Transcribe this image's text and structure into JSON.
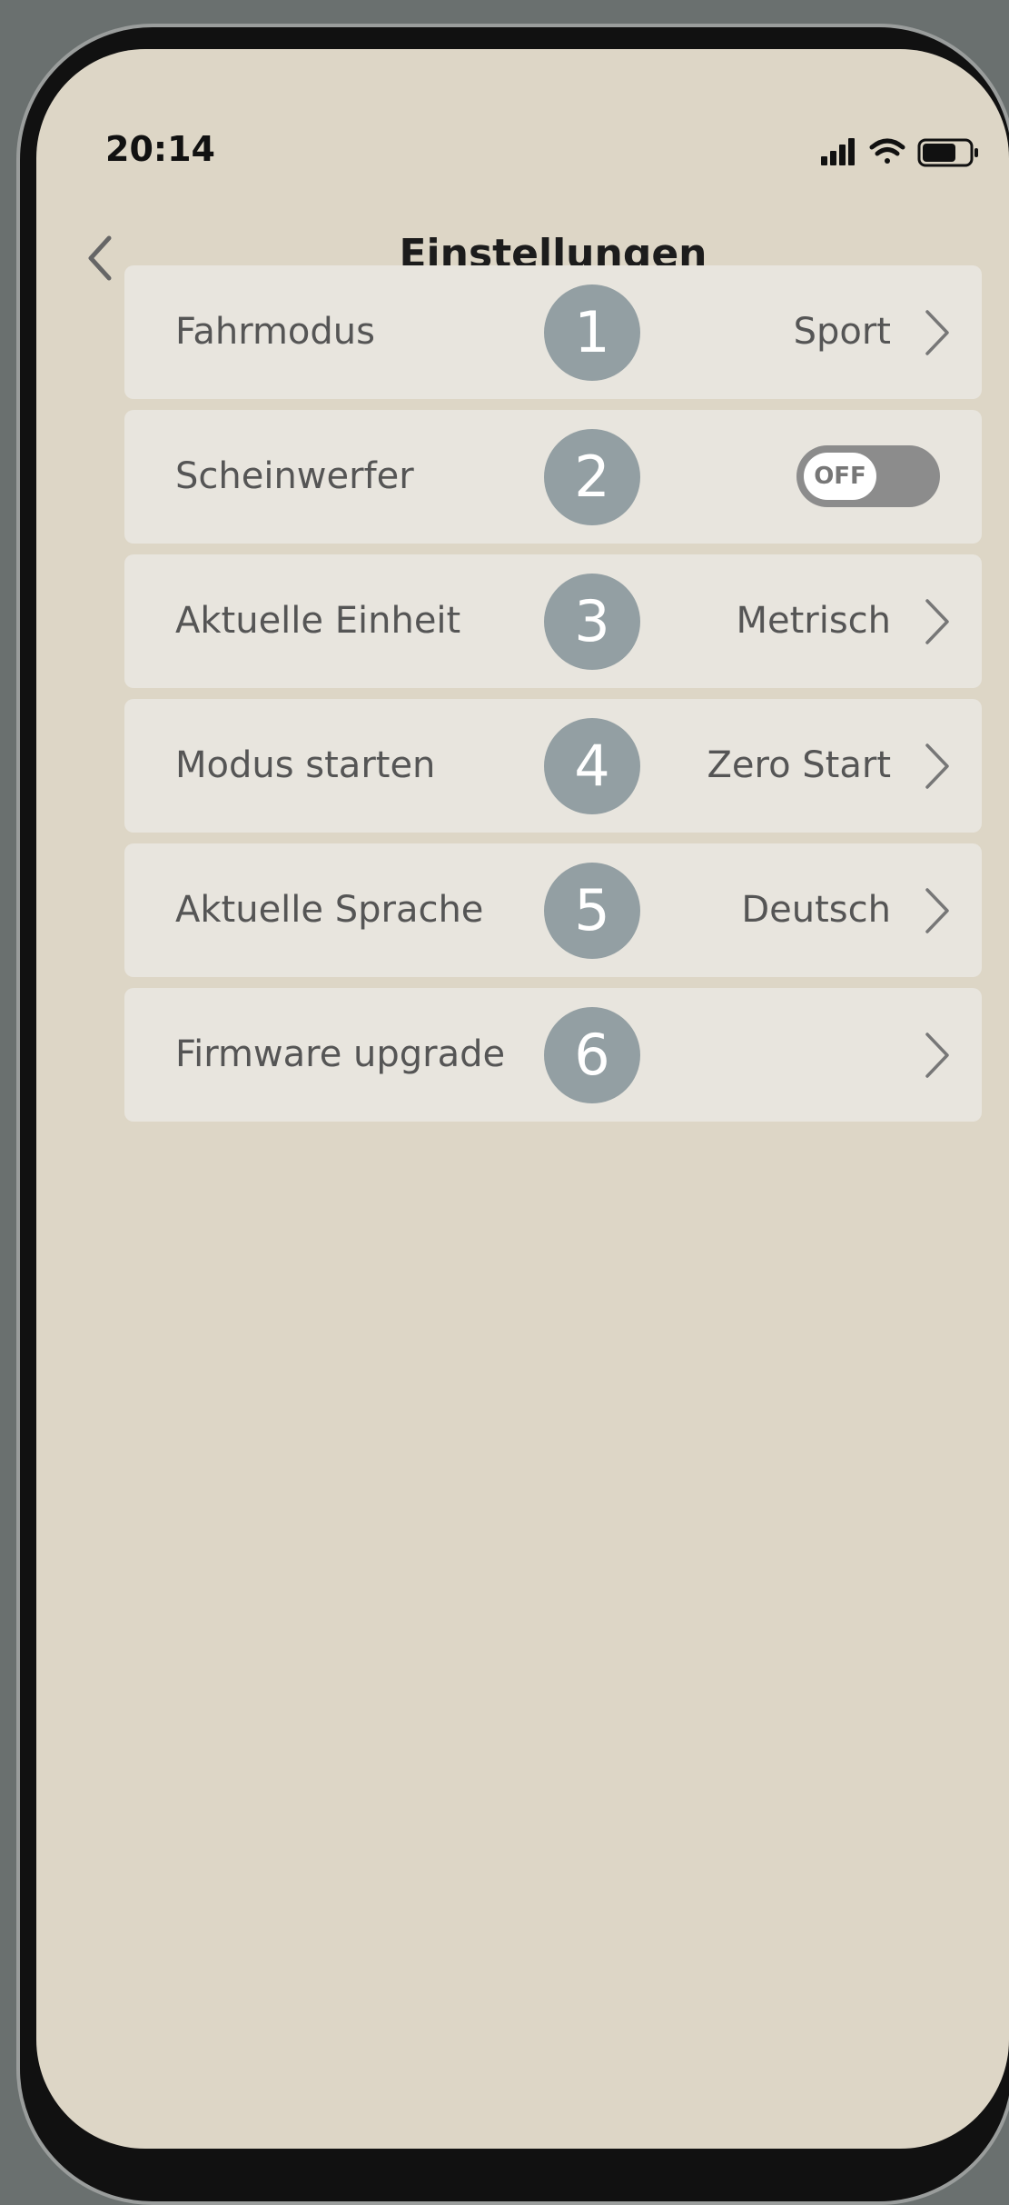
{
  "status_bar": {
    "time": "20:14",
    "icons": [
      "signal-icon",
      "wifi-icon",
      "battery-icon"
    ]
  },
  "header": {
    "back_icon": "chevron-left-icon",
    "title": "Einstellungen"
  },
  "settings": [
    {
      "label": "Fahrmodus",
      "badge": "1",
      "value": "Sport",
      "has_chevron": true
    },
    {
      "label": "Scheinwerfer",
      "badge": "2",
      "toggle_state": "OFF"
    },
    {
      "label": "Aktuelle Einheit",
      "badge": "3",
      "value": "Metrisch",
      "has_chevron": true
    },
    {
      "label": "Modus starten",
      "badge": "4",
      "value": "Zero Start",
      "has_chevron": true
    },
    {
      "label": "Aktuelle Sprache",
      "badge": "5",
      "value": "Deutsch",
      "has_chevron": true
    },
    {
      "label": "Firmware upgrade",
      "badge": "6",
      "value": "",
      "has_chevron": true
    }
  ],
  "colors": {
    "screen_bg": "#ddd6c6",
    "row_bg": "#e8e5de",
    "badge_bg": "#939fa3",
    "frame_bg": "#6a706f"
  }
}
